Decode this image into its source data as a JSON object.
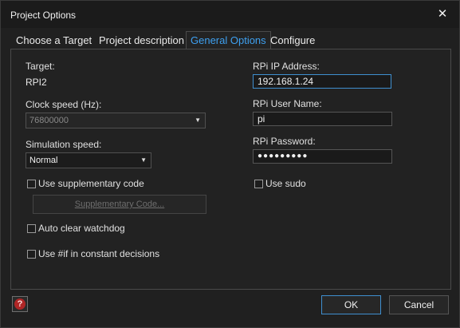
{
  "window": {
    "title": "Project Options"
  },
  "tabs": [
    {
      "label": "Choose a Target"
    },
    {
      "label": "Project description"
    },
    {
      "label": "General Options"
    },
    {
      "label": "Configure"
    }
  ],
  "active_tab": "General Options",
  "general": {
    "target_label": "Target:",
    "target_value": "RPI2",
    "clock_label": "Clock speed (Hz):",
    "clock_value": "76800000",
    "sim_label": "Simulation speed:",
    "sim_value": "Normal",
    "supp_code_label": "Use supplementary code",
    "supp_code_button": "Supplementary Code...",
    "watchdog_label": "Auto clear watchdog",
    "ifdef_label": "Use #if in constant decisions"
  },
  "rpi": {
    "ip_label": "RPi IP Address:",
    "ip_value": "192.168.1.24",
    "user_label": "RPi User Name:",
    "user_value": "pi",
    "pass_label": "RPi Password:",
    "pass_value": "●●●●●●●●●",
    "sudo_label": "Use sudo"
  },
  "buttons": {
    "ok": "OK",
    "cancel": "Cancel",
    "help_glyph": "?"
  },
  "colors": {
    "accent": "#3ea0f0",
    "focus_border": "#3f8fd0",
    "help_red": "#b02626"
  }
}
